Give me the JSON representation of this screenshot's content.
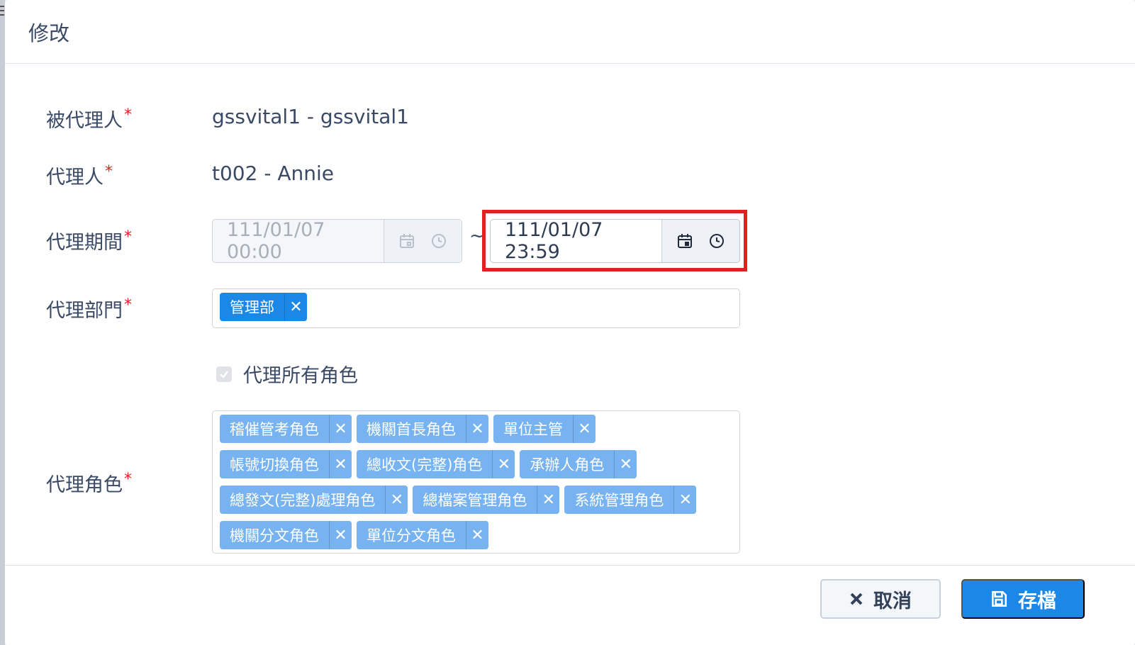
{
  "modal": {
    "title": "修改"
  },
  "fields": {
    "principal": {
      "label": "被代理人",
      "required": "*",
      "value": "gssvital1 - gssvital1"
    },
    "agent": {
      "label": "代理人",
      "required": "*",
      "value": "t002 - Annie"
    },
    "period": {
      "label": "代理期間",
      "required": "*",
      "start": "111/01/07 00:00",
      "separator": "~",
      "end": "111/01/07 23:59"
    },
    "department": {
      "label": "代理部門",
      "required": "*",
      "tags": [
        "管理部"
      ],
      "remove_symbol": "✕"
    },
    "all_roles": {
      "label": "代理所有角色",
      "checked": true
    },
    "roles": {
      "label": "代理角色",
      "required": "*",
      "tags": [
        "稽催管考角色",
        "機關首長角色",
        "單位主管",
        "帳號切換角色",
        "總收文(完整)角色",
        "承辦人角色",
        "總發文(完整)處理角色",
        "總檔案管理角色",
        "系統管理角色",
        "機關分文角色",
        "單位分文角色"
      ]
    }
  },
  "footer": {
    "cancel_label": "取消",
    "save_label": "存檔"
  },
  "colors": {
    "primary": "#1b87e6",
    "tag_disabled": "#76b3f0",
    "highlight": "#e32020",
    "required": "#e02424"
  },
  "icons": [
    "calendar-icon",
    "clock-icon",
    "close-icon",
    "save-icon"
  ]
}
